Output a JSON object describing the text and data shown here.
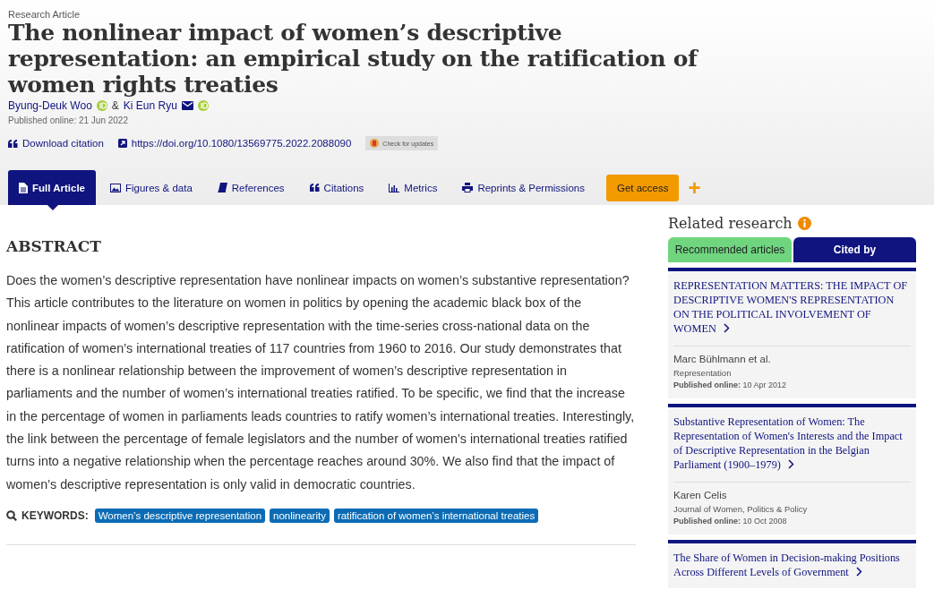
{
  "header": {
    "article_type": "Research Article",
    "title": "The nonlinear impact of women’s descriptive representation: an empirical study on the ratification of women rights treaties",
    "authors": [
      {
        "name": "Byung-Deuk Woo",
        "orcid": true,
        "email": false
      },
      {
        "name": "Ki Eun Ryu",
        "orcid": true,
        "email": true
      }
    ],
    "author_separator": "&",
    "published": "Published online: 21 Jun 2022",
    "download_citation": "Download citation",
    "doi": "https://doi.org/10.1080/13569775.2022.2088090",
    "check_updates": "Check for updates"
  },
  "tabs": [
    {
      "label": "Full Article",
      "selected": true
    },
    {
      "label": "Figures & data",
      "selected": false
    },
    {
      "label": "References",
      "selected": false
    },
    {
      "label": "Citations",
      "selected": false
    },
    {
      "label": "Metrics",
      "selected": false
    },
    {
      "label": "Reprints & Permissions",
      "selected": false
    }
  ],
  "get_access": "Get access",
  "more": "+",
  "abstract": {
    "heading": "ABSTRACT",
    "text": "Does the women’s descriptive representation have nonlinear impacts on women’s substantive representation? This article contributes to the literature on women in politics by opening the academic black box of the nonlinear impacts of women’s descriptive representation with the time-series cross-national data on the ratification of women’s international treaties of 117 countries from 1960 to 2016. Our study demonstrates that there is a nonlinear relationship between the improvement of women’s descriptive representation in parliaments and the number of women’s international treaties ratified. To be specific, we find that the increase in the percentage of women in parliaments leads countries to ratify women’s international treaties. Interestingly, the link between the percentage of female legislators and the number of women’s international treaties ratified turns into a negative relationship when the percentage reaches around 30%. We also find that the impact of women’s descriptive representation is only valid in democratic countries."
  },
  "keywords": {
    "label": "KEYWORDS:",
    "items": [
      "Women’s descriptive representation",
      "nonlinearity",
      "ratification of women’s international treaties"
    ]
  },
  "related": {
    "heading": "Related research",
    "tabs": [
      {
        "label": "Recommended articles",
        "selected": true
      },
      {
        "label": "Cited by",
        "selected": false
      }
    ],
    "articles": [
      {
        "title": "REPRESENTATION MATTERS: THE IMPACT OF DESCRIPTIVE WOMEN'S REPRESENTATION ON THE POLITICAL INVOLVEMENT OF WOMEN",
        "authors": "Marc Bühlmann et al.",
        "journal": "Representation",
        "published_label": "Published online:",
        "published_date": "10 Apr 2012"
      },
      {
        "title": "Substantive Representation of Women: The Representation of Women's Interests and the Impact of Descriptive Representation in the Belgian Parliament (1900–1979)",
        "authors": "Karen Celis",
        "journal": "Journal of Women, Politics & Policy",
        "published_label": "Published online:",
        "published_date": "10 Oct 2008"
      },
      {
        "title": "The Share of Women in Decision-making Positions Across Different Levels of Government"
      }
    ]
  }
}
